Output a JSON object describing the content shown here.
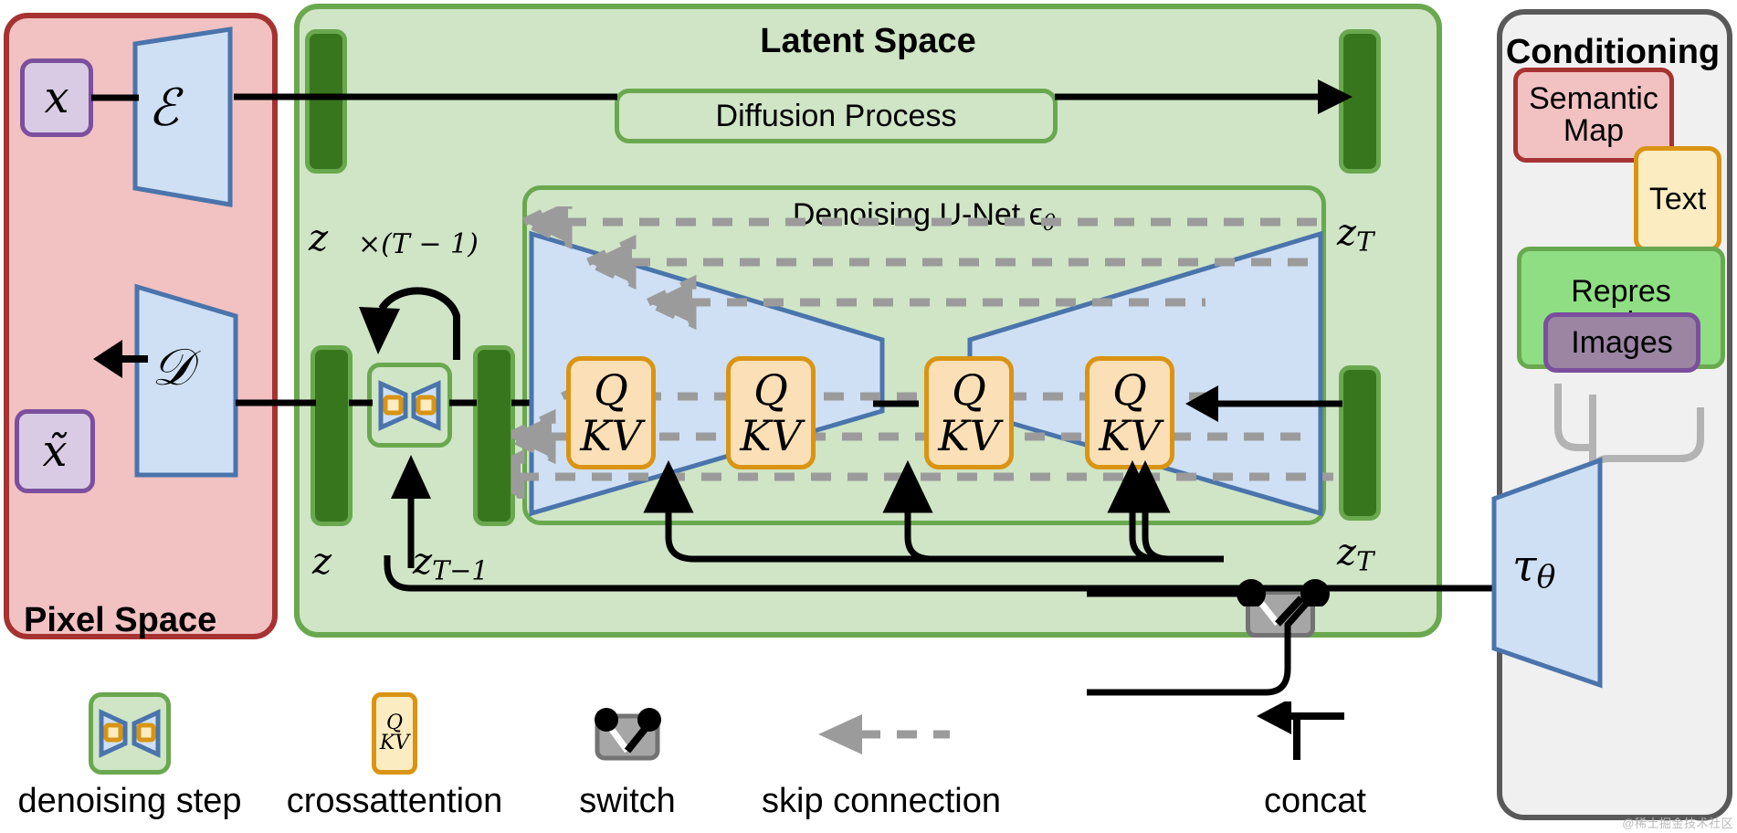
{
  "panels": {
    "pixel_space": {
      "title": "Pixel Space",
      "bg": "#f2c1c1",
      "border": "#a63232"
    },
    "latent_space": {
      "title": "Latent Space",
      "bg": "#cfe5c6",
      "border": "#6aa84f"
    },
    "conditioning": {
      "title": "Conditioning",
      "bg": "#f0f0f0",
      "border": "#595959"
    }
  },
  "pixel": {
    "input_symbol": "x",
    "output_symbol": "x̃",
    "encoder_symbol": "ℰ",
    "decoder_symbol": "𝒟"
  },
  "latent": {
    "diffusion_label": "Diffusion Process",
    "unet_label": "Denoising U-Net ϵ",
    "unet_label_sub": "θ",
    "z_top": "z",
    "z_T_top": "z",
    "z_T_top_sub": "T",
    "z_bottom": "z",
    "z_T_minus_1": "z",
    "z_T_minus_1_sub": "T−1",
    "z_T_bottom": "z",
    "z_T_bottom_sub": "T",
    "loop_label": "×(T − 1)"
  },
  "attention_blocks": [
    {
      "q": "Q",
      "kv": "KV"
    },
    {
      "q": "Q",
      "kv": "KV"
    },
    {
      "q": "Q",
      "kv": "KV"
    },
    {
      "q": "Q",
      "kv": "KV"
    }
  ],
  "conditioning": {
    "tau_symbol": "τ",
    "tau_sub": "θ",
    "chips": [
      {
        "label": "Semantic Map",
        "bg": "#f2c1c1",
        "border": "#a63232"
      },
      {
        "label": "Text",
        "bg": "#fbecc2",
        "border": "#d99413"
      },
      {
        "label": "Repres entations",
        "bg": "#8fde84",
        "border": "#6aa84f"
      },
      {
        "label": "Images",
        "bg": "#9b85a3",
        "border": "#7b4f9d"
      }
    ]
  },
  "legend": [
    {
      "icon": "denoising-step-icon",
      "label": "denoising step"
    },
    {
      "icon": "crossattention-icon",
      "label": "crossattention"
    },
    {
      "icon": "switch-icon",
      "label": "switch"
    },
    {
      "icon": "skip-connection-icon",
      "label": "skip connection"
    },
    {
      "icon": "concat-icon",
      "label": "concat"
    }
  ],
  "colors": {
    "latent_bar": "#38761d",
    "green_border": "#6aa84f",
    "trapezoid_fill": "#cfe0f5",
    "trapezoid_stroke": "#4a74ab",
    "attention_fill": "#fbdfb6",
    "attention_stroke": "#d99413",
    "skip_gray": "#9b9b9b",
    "switch_gray": "#a6a6a6"
  },
  "watermark": "@稀土掘金技术社区"
}
